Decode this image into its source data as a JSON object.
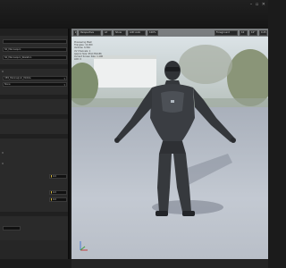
{
  "viewport": {
    "toolbar": {
      "perspective_label": "Perspective",
      "lit_label": "Lit",
      "show_label": "Show",
      "lod_label": "LOD Auto",
      "speed_label": "100%",
      "foreground_label": "Foreground",
      "grid_value": "10",
      "angle_value": "10°",
      "scale_value": "0.25"
    },
    "stats_lines": "Previewing Mesh\nTriangles: 12,000\nVertices: 6,562\nUV Channels: 1\nApprox Size: 95x178x186\nCurrent Screen Size: 1.196\nLOD: 0"
  },
  "details": {
    "mesh_name": "SK_Mannequin",
    "skeleton_name": "SK_Mannequin_Skeleton",
    "property_value": "UE4_Mannequin_Mobile",
    "property_value_2": "None",
    "translation_x": "0.0",
    "translation_y": "0.0",
    "translation_z": "0.0"
  },
  "colors": {
    "accent": "#e0c040",
    "panel": "#2a2a2a",
    "viewport_floor": "#b9bfc8"
  }
}
